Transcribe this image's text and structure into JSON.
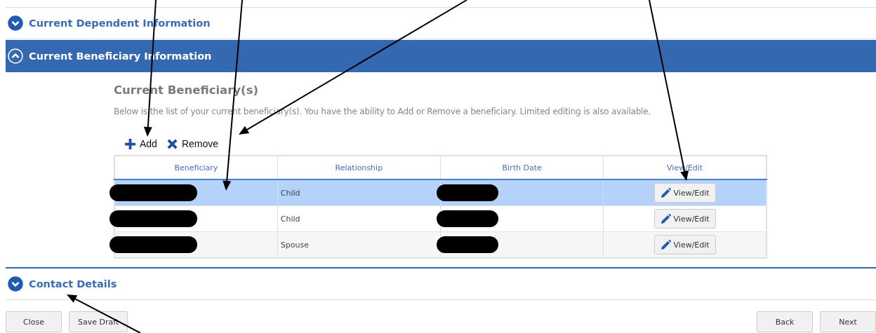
{
  "sections": [
    {
      "title": "Current Dependent Information",
      "expanded": false
    },
    {
      "title": "Current Beneficiary Information",
      "expanded": true,
      "heading": "Current Beneficiary(s)",
      "description": "Below is the list of your current beneficiary(s). You have the ability to Add or Remove a beneficiary. Limited editing is also available.",
      "toolbar": [
        {
          "kind": "add",
          "label": "Add"
        },
        {
          "kind": "remove",
          "label": "Remove"
        }
      ],
      "table": {
        "columns": [
          "Beneficiary",
          "Relationship",
          "Birth Date",
          "View/Edit"
        ],
        "rows": [
          {
            "redacted": true,
            "relationship": "Child",
            "action": "View/Edit",
            "selected": true
          },
          {
            "redacted": true,
            "relationship": "Child",
            "action": "View/Edit",
            "selected": false
          },
          {
            "redacted": true,
            "relationship": "Spouse",
            "action": "View/Edit",
            "selected": false
          }
        ]
      }
    },
    {
      "title": "Contact Details",
      "expanded": false
    }
  ],
  "footer": {
    "left": [
      "Close",
      "Save Draft"
    ],
    "right": [
      "Back",
      "Next"
    ]
  }
}
